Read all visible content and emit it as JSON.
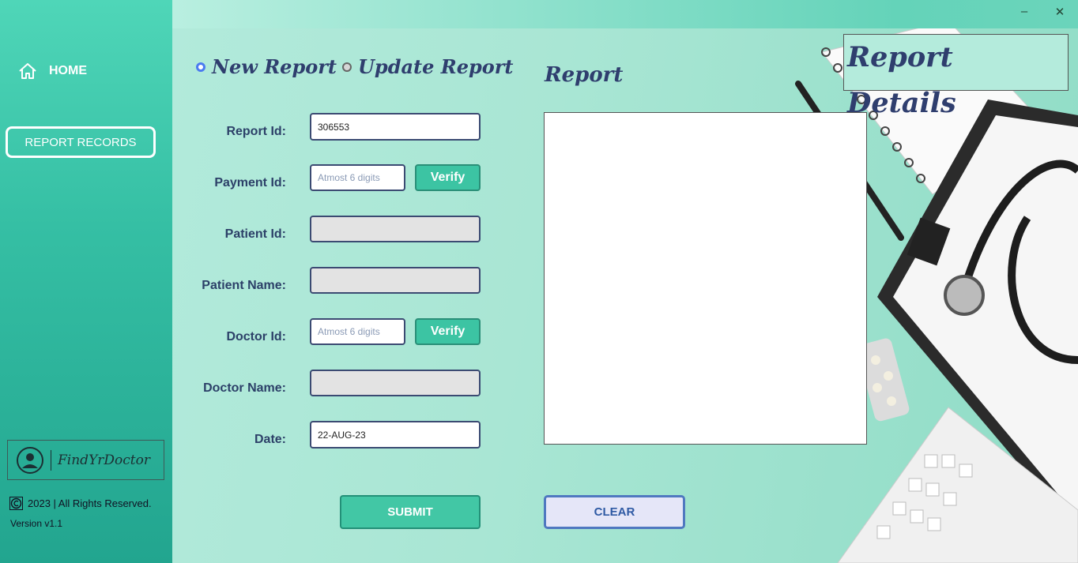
{
  "sidebar": {
    "home_label": "HOME",
    "records_label": "REPORT RECORDS",
    "logo_text": "FindYrDoctor",
    "copyright_text": "2023 | All Rights Reserved.",
    "version_text": "Version v1.1"
  },
  "window": {
    "minimize": "–",
    "close": "✕"
  },
  "mode": {
    "new_label": "New Report",
    "update_label": "Update Report",
    "selected": "New Report"
  },
  "form": {
    "report_id_label": "Report Id:",
    "report_id_value": "306553",
    "payment_id_label": "Payment Id:",
    "payment_id_placeholder": "Atmost 6 digits",
    "verify_label": "Verify",
    "patient_id_label": "Patient Id:",
    "patient_name_label": "Patient Name:",
    "doctor_id_label": "Doctor Id:",
    "doctor_id_placeholder": "Atmost 6 digits",
    "doctor_name_label": "Doctor Name:",
    "date_label": "Date:",
    "date_value": "22-AUG-23",
    "submit_label": "SUBMIT"
  },
  "report": {
    "title": "Report",
    "clear_label": "CLEAR",
    "details_heading": "Report Details"
  },
  "colors": {
    "sidebar_accent": "#35bfa4",
    "primary_button": "#42c7a5",
    "heading_text": "#2f3e6e",
    "radio_selected": "#4b7bf0"
  }
}
